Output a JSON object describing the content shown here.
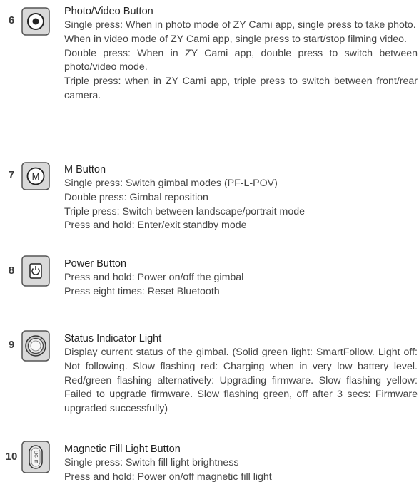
{
  "items": [
    {
      "number": "6",
      "icon": "photo-video-button-icon",
      "title": "Photo/Video Button",
      "paragraphs": [
        "Single press: When in photo mode of ZY Cami app, single press to take photo.",
        "When in video mode of ZY Cami app, single press to start/stop filming video.",
        "Double press: When in ZY Cami app, double press to switch between photo/video mode.",
        "Triple press: when in ZY Cami app, triple press to switch between front/rear camera."
      ]
    },
    {
      "number": "7",
      "icon": "m-button-icon",
      "icon_letter": "M",
      "title": "M Button",
      "paragraphs": [
        "Single press: Switch gimbal modes (PF-L-POV)",
        "Double press: Gimbal reposition",
        "Triple press: Switch between landscape/portrait mode",
        "Press and hold: Enter/exit standby mode"
      ]
    },
    {
      "number": "8",
      "icon": "power-button-icon",
      "title": "Power Button",
      "paragraphs": [
        "Press and hold: Power on/off the gimbal",
        "Press eight times: Reset Bluetooth"
      ]
    },
    {
      "number": "9",
      "icon": "status-indicator-light-icon",
      "title": "Status Indicator Light",
      "paragraphs": [
        "Display current status of the gimbal. (Solid green light: SmartFollow. Light off: Not following. Slow flashing red: Charging when in very low battery level. Red/green flashing alternatively: Upgrading firmware. Slow flashing yellow: Failed to upgrade firmware. Slow flashing green, off after 3 secs: Firmware upgraded successfully)"
      ]
    },
    {
      "number": "10",
      "icon": "magnetic-fill-light-button-icon",
      "icon_letter": "LIGHT",
      "title": "Magnetic Fill Light Button",
      "paragraphs": [
        "Single press: Switch fill light brightness",
        "Press and hold: Power on/off magnetic fill light"
      ]
    }
  ]
}
